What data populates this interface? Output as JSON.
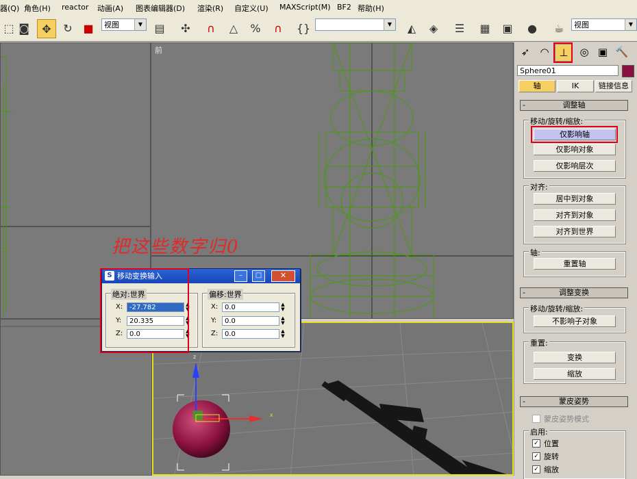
{
  "menu": [
    "器(Q)",
    "角色(H)",
    "reactor",
    "动画(A)",
    "图表编辑器(D)",
    "渲染(R)",
    "自定义(U)",
    "MAXScript(M)",
    "BF2",
    "帮助(H)"
  ],
  "toolbar": {
    "ref_coord": "视图",
    "selection_set": "",
    "view_combo": "视图"
  },
  "viewports": {
    "front_label": "前"
  },
  "annotation": "把这些数字归0",
  "command_panel": {
    "object_name": "Sphere01",
    "object_color": "#8b1040",
    "tabs": {
      "pivot": "轴",
      "ik": "IK",
      "link_info": "链接信息"
    },
    "adjust_pivot": {
      "title": "调整轴",
      "move_rotate_scale": "移动/旋转/缩放:",
      "affect_pivot_only": "仅影响轴",
      "affect_object_only": "仅影响对象",
      "affect_hierarchy_only": "仅影响层次",
      "alignment": "对齐:",
      "center_to_object": "居中到对象",
      "align_to_object": "对齐到对象",
      "align_to_world": "对齐到世界",
      "pivot": "轴:",
      "reset_pivot": "重置轴"
    },
    "adjust_transform": {
      "title": "调整变换",
      "move_rotate_scale": "移动/旋转/缩放:",
      "dont_affect_children": "不影响子对象",
      "reset": "重置:",
      "transform": "变换",
      "scale": "缩放"
    },
    "skin_pose": {
      "title": "蒙皮姿势",
      "skin_pose_mode": "蒙皮姿势模式",
      "enabled": "启用:",
      "position": "位置",
      "rotation": "旋转",
      "scale": "缩放"
    }
  },
  "dialog": {
    "title": "移动变换输入",
    "absolute": "绝对:世界",
    "offset": "偏移:世界",
    "abs_x": "-27.782",
    "abs_y": "20.335",
    "abs_z": "0.0",
    "off_x": "0.0",
    "off_y": "0.0",
    "off_z": "0.0",
    "x_label": "X:",
    "y_label": "Y:",
    "z_label": "Z:"
  },
  "gizmo": {
    "x": "x",
    "z": "z"
  },
  "colors": {
    "wireframe": "#4a9a10",
    "accent": "#f5cf61",
    "highlight": "#e0001a"
  }
}
